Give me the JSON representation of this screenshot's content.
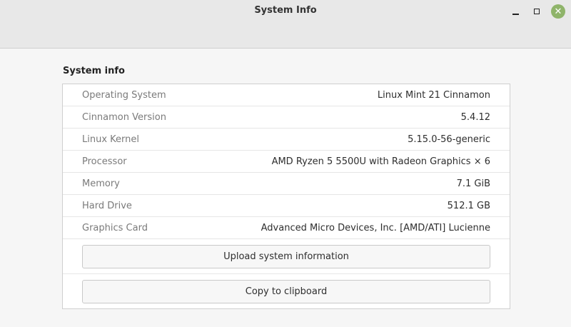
{
  "window": {
    "title": "System Info"
  },
  "section_title": "System info",
  "rows": [
    {
      "label": "Operating System",
      "value": "Linux Mint 21 Cinnamon"
    },
    {
      "label": "Cinnamon Version",
      "value": "5.4.12"
    },
    {
      "label": "Linux Kernel",
      "value": "5.15.0-56-generic"
    },
    {
      "label": "Processor",
      "value": "AMD Ryzen 5 5500U with Radeon Graphics × 6"
    },
    {
      "label": "Memory",
      "value": "7.1 GiB"
    },
    {
      "label": "Hard Drive",
      "value": "512.1 GB"
    },
    {
      "label": "Graphics Card",
      "value": "Advanced Micro Devices, Inc. [AMD/ATI] Lucienne"
    }
  ],
  "buttons": {
    "upload": "Upload system information",
    "copy": "Copy to clipboard"
  },
  "colors": {
    "close_button": "#8fb46a"
  }
}
